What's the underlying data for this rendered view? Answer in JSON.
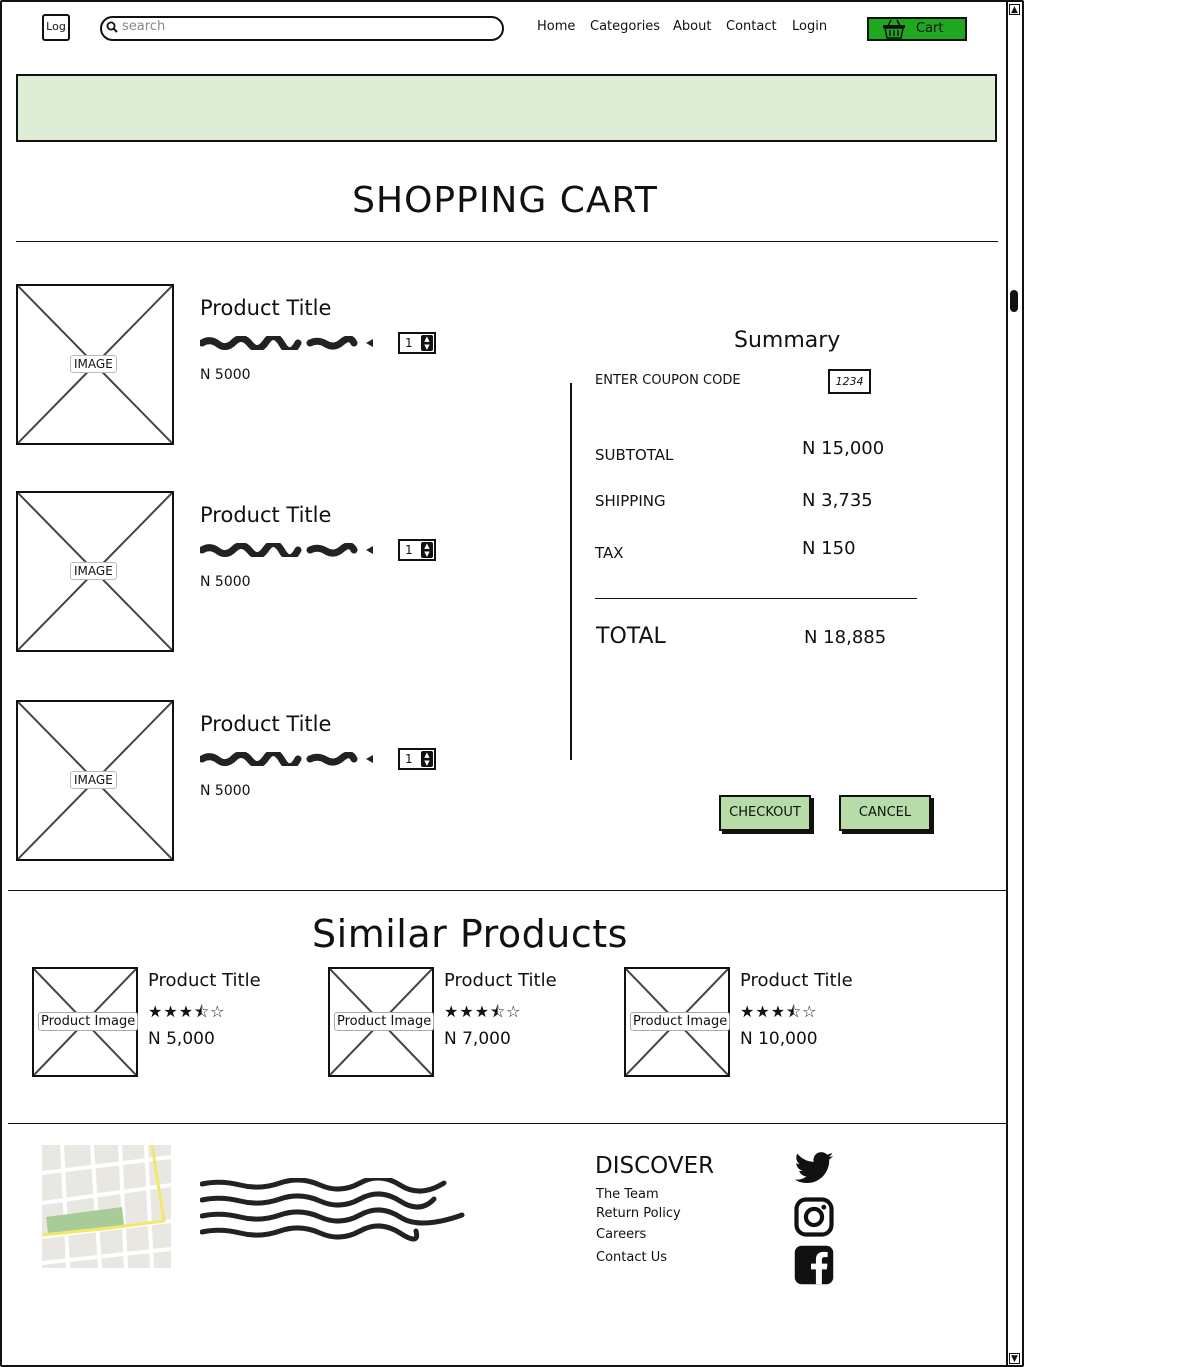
{
  "header": {
    "logo_text": "Log",
    "search_placeholder": "search",
    "nav": [
      "Home",
      "Categories",
      "About",
      "Contact",
      "Login"
    ],
    "cart_label": "Cart"
  },
  "page_title": "SHOPPING CART",
  "cart_items": [
    {
      "image_label": "IMAGE",
      "title": "Product Title",
      "qty": "1",
      "price": "N 5000"
    },
    {
      "image_label": "IMAGE",
      "title": "Product Title",
      "qty": "1",
      "price": "N 5000"
    },
    {
      "image_label": "IMAGE",
      "title": "Product Title",
      "qty": "1",
      "price": "N 5000"
    }
  ],
  "summary": {
    "title": "Summary",
    "coupon_label": "ENTER COUPON CODE",
    "coupon_value": "1234",
    "subtotal_label": "SUBTOTAL",
    "subtotal_value": "N 15,000",
    "shipping_label": "SHIPPING",
    "shipping_value": "N 3,735",
    "tax_label": "TAX",
    "tax_value": "N 150",
    "total_label": "TOTAL",
    "total_value": "N 18,885",
    "checkout_label": "CHECKOUT",
    "cancel_label": "CANCEL"
  },
  "similar": {
    "title": "Similar Products",
    "products": [
      {
        "image_label": "Product Image",
        "title": "Product Title",
        "rating": 3.5,
        "price": "N 5,000"
      },
      {
        "image_label": "Product Image",
        "title": "Product Title",
        "rating": 3.5,
        "price": "N 7,000"
      },
      {
        "image_label": "Product Image",
        "title": "Product Title",
        "rating": 3.5,
        "price": "N 10,000"
      }
    ]
  },
  "footer": {
    "discover_title": "DISCOVER",
    "links": [
      "The Team",
      "Return Policy",
      "Careers",
      "Contact Us"
    ],
    "social_icons": [
      "twitter-icon",
      "instagram-icon",
      "facebook-icon"
    ]
  },
  "colors": {
    "cart_button": "#1fa71f",
    "banner": "#ddedd6",
    "action_button": "#b8dca8"
  }
}
